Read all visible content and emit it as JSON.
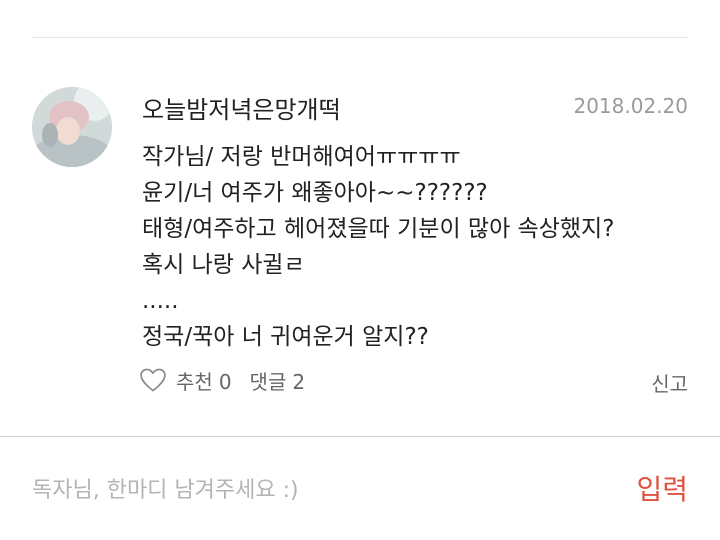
{
  "comment": {
    "username": "오늘밤저녁은망개떡",
    "date": "2018.02.20",
    "lines": [
      "작가님/ 저랑 반머해여어ㅠㅠㅠㅠ",
      "윤기/너 여주가 왜좋아아~~??????",
      "태형/여주하고 헤어졌을따 기분이 많아 속상했지?",
      "혹시 나랑 사귈ㄹ",
      ".....",
      "정국/꾹아 너 귀여운거 알지??"
    ],
    "actions": {
      "like_icon": "heart-outline-icon",
      "like_label": "추천",
      "like_count": "0",
      "reply_label": "댓글",
      "reply_count": "2",
      "report_label": "신고"
    }
  },
  "footer": {
    "placeholder": "독자님, 한마디 남겨주세요 :)",
    "value": "",
    "submit_label": "입력"
  },
  "colors": {
    "accent": "#e0523f",
    "text": "#222222",
    "muted": "#9a9a9a"
  }
}
